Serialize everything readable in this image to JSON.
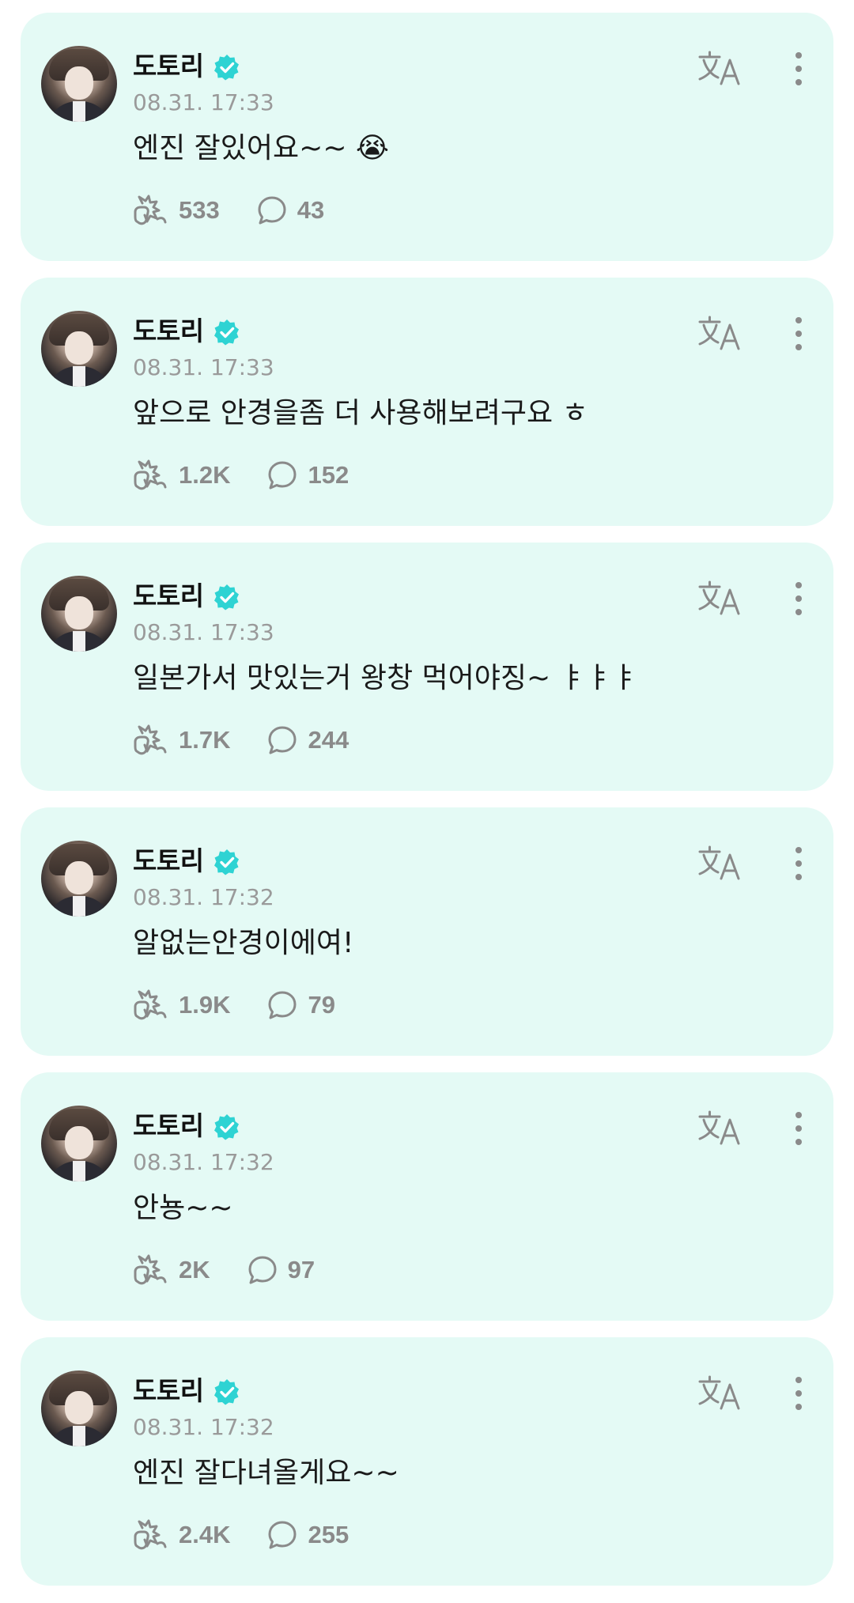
{
  "colors": {
    "card_background": "#e4faf5",
    "verified_badge": "#2ed3d3",
    "meta_text": "#9a9a9a",
    "action_icon": "#8a8a8a"
  },
  "posts": [
    {
      "author": "도토리",
      "verified_icon": "verified-badge-icon",
      "timestamp": "08.31. 17:33",
      "text": "엔진 잘있어요~~ 😭",
      "likes": "533",
      "comments": "43"
    },
    {
      "author": "도토리",
      "verified_icon": "verified-badge-icon",
      "timestamp": "08.31. 17:33",
      "text": "앞으로 안경을좀 더 사용해보려구요 ㅎ",
      "likes": "1.2K",
      "comments": "152"
    },
    {
      "author": "도토리",
      "verified_icon": "verified-badge-icon",
      "timestamp": "08.31. 17:33",
      "text": "일본가서 맛있는거 왕창 먹어야징~ ㅑㅑㅑ",
      "likes": "1.7K",
      "comments": "244"
    },
    {
      "author": "도토리",
      "verified_icon": "verified-badge-icon",
      "timestamp": "08.31. 17:32",
      "text": "알없는안경이에여!",
      "likes": "1.9K",
      "comments": "79"
    },
    {
      "author": "도토리",
      "verified_icon": "verified-badge-icon",
      "timestamp": "08.31. 17:32",
      "text": "안뇽~~",
      "likes": "2K",
      "comments": "97"
    },
    {
      "author": "도토리",
      "verified_icon": "verified-badge-icon",
      "timestamp": "08.31. 17:32",
      "text": "엔진 잘다녀올게요~~",
      "likes": "2.4K",
      "comments": "255"
    }
  ]
}
